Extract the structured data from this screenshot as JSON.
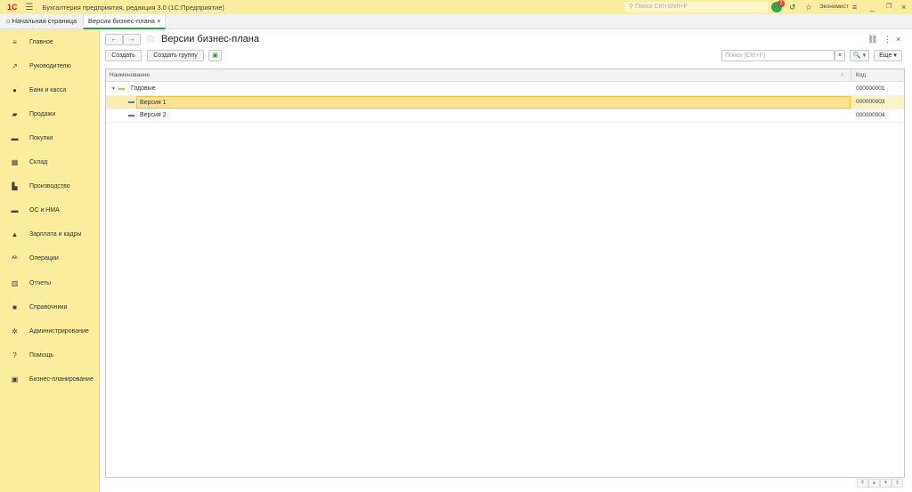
{
  "app": {
    "logo": "1С",
    "title": "Бухгалтерия предприятия, редакция 3.0  (1С:Предприятие)",
    "search_placeholder": "Поиск Ctrl+Shift+F",
    "notifications": "2",
    "user": "Экономист"
  },
  "tabs": [
    {
      "label": "Начальная страница"
    },
    {
      "label": "Версии бизнес-плана",
      "close": "×"
    }
  ],
  "sidebar": {
    "items": [
      {
        "label": "Главное",
        "icon": "≡"
      },
      {
        "label": "Руководителю",
        "icon": "↗"
      },
      {
        "label": "Банк и касса",
        "icon": "●"
      },
      {
        "label": "Продажи",
        "icon": "▰"
      },
      {
        "label": "Покупки",
        "icon": "▬"
      },
      {
        "label": "Склад",
        "icon": "▦"
      },
      {
        "label": "Производство",
        "icon": "▙"
      },
      {
        "label": "ОС и НМА",
        "icon": "▬"
      },
      {
        "label": "Зарплата и кадры",
        "icon": "▲"
      },
      {
        "label": "Операции",
        "icon": "ᴬᵏ"
      },
      {
        "label": "Отчеты",
        "icon": "▥"
      },
      {
        "label": "Справочники",
        "icon": "■"
      },
      {
        "label": "Администрирование",
        "icon": "✲"
      },
      {
        "label": "Помощь",
        "icon": "?"
      },
      {
        "label": "Бизнес-планирование",
        "icon": "▣"
      }
    ]
  },
  "form": {
    "title": "Версии бизнес-плана",
    "create": "Создать",
    "create_group": "Создать группу",
    "search_placeholder": "Поиск (Ctrl+F)",
    "search_clear": "×",
    "more": "Еще ▾",
    "search_btn": "🔍 ▾"
  },
  "table": {
    "columns": [
      "Наименование",
      "Код"
    ],
    "sort": "↓",
    "rows": [
      {
        "name": "Годовые",
        "code": "000000001",
        "type": "group"
      },
      {
        "name": "Версия 1",
        "code": "000000003",
        "type": "item",
        "selected": true
      },
      {
        "name": "Версия 2",
        "code": "000000004",
        "type": "item"
      }
    ]
  }
}
